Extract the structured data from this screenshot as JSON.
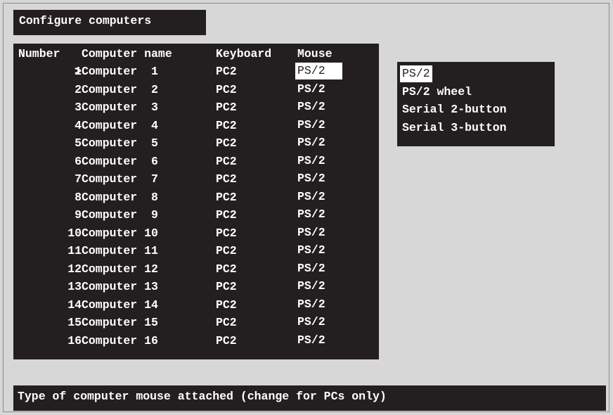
{
  "title": "Configure computers",
  "columns": {
    "number": "Number",
    "name": "Computer name",
    "keyboard": "Keyboard",
    "mouse": "Mouse"
  },
  "selected_row": 0,
  "rows": [
    {
      "number": "1",
      "name": "Computer  1",
      "keyboard": "PC2",
      "mouse": "PS/2"
    },
    {
      "number": "2",
      "name": "Computer  2",
      "keyboard": "PC2",
      "mouse": "PS/2"
    },
    {
      "number": "3",
      "name": "Computer  3",
      "keyboard": "PC2",
      "mouse": "PS/2"
    },
    {
      "number": "4",
      "name": "Computer  4",
      "keyboard": "PC2",
      "mouse": "PS/2"
    },
    {
      "number": "5",
      "name": "Computer  5",
      "keyboard": "PC2",
      "mouse": "PS/2"
    },
    {
      "number": "6",
      "name": "Computer  6",
      "keyboard": "PC2",
      "mouse": "PS/2"
    },
    {
      "number": "7",
      "name": "Computer  7",
      "keyboard": "PC2",
      "mouse": "PS/2"
    },
    {
      "number": "8",
      "name": "Computer  8",
      "keyboard": "PC2",
      "mouse": "PS/2"
    },
    {
      "number": "9",
      "name": "Computer  9",
      "keyboard": "PC2",
      "mouse": "PS/2"
    },
    {
      "number": "10",
      "name": "Computer 10",
      "keyboard": "PC2",
      "mouse": "PS/2"
    },
    {
      "number": "11",
      "name": "Computer 11",
      "keyboard": "PC2",
      "mouse": "PS/2"
    },
    {
      "number": "12",
      "name": "Computer 12",
      "keyboard": "PC2",
      "mouse": "PS/2"
    },
    {
      "number": "13",
      "name": "Computer 13",
      "keyboard": "PC2",
      "mouse": "PS/2"
    },
    {
      "number": "14",
      "name": "Computer 14",
      "keyboard": "PC2",
      "mouse": "PS/2"
    },
    {
      "number": "15",
      "name": "Computer 15",
      "keyboard": "PC2",
      "mouse": "PS/2"
    },
    {
      "number": "16",
      "name": "Computer 16",
      "keyboard": "PC2",
      "mouse": "PS/2"
    }
  ],
  "cursor_marker": ">",
  "mouse_options": [
    "PS/2",
    "PS/2 wheel",
    "Serial 2-button",
    "Serial 3-button"
  ],
  "selected_option": 0,
  "status_text": "Type of computer mouse attached (change for PCs only)",
  "colors": {
    "panel": "#231f20",
    "background": "#d7d7d7",
    "text": "#ffffff",
    "highlight": "#ffffff"
  }
}
